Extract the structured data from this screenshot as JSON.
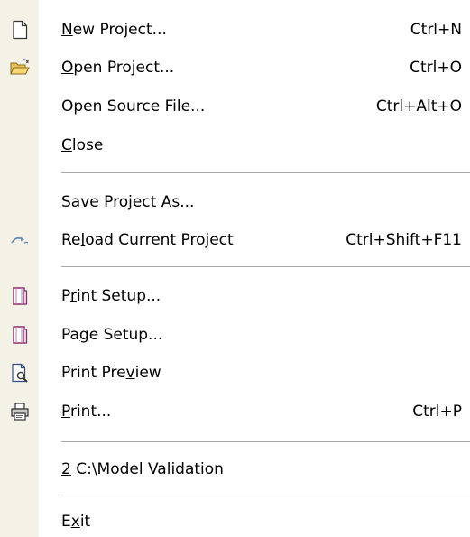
{
  "menu": {
    "colors": {
      "gutter": "#f4f2e7",
      "background": "#ffffff",
      "separator": "#a8a8a8"
    },
    "items": [
      {
        "pre": "",
        "mn": "N",
        "post": "ew Project...",
        "shortcut": "Ctrl+N",
        "icon": "new-project-icon"
      },
      {
        "pre": "",
        "mn": "O",
        "post": "pen Project...",
        "shortcut": "Ctrl+O",
        "icon": "open-folder-icon"
      },
      {
        "pre": "Open Source File...",
        "mn": "",
        "post": "",
        "shortcut": "Ctrl+Alt+O",
        "icon": ""
      },
      {
        "pre": "",
        "mn": "C",
        "post": "lose",
        "shortcut": "",
        "icon": ""
      },
      {
        "pre": "Save Project ",
        "mn": "A",
        "post": "s...",
        "shortcut": "",
        "icon": ""
      },
      {
        "pre": "Re",
        "mn": "l",
        "post": "oad Current Project",
        "shortcut": "Ctrl+Shift+F11",
        "icon": "reload-icon"
      },
      {
        "pre": "P",
        "mn": "r",
        "post": "int Setup...",
        "shortcut": "",
        "icon": "print-setup-icon"
      },
      {
        "pre": "Pa",
        "mn": "g",
        "post": "e Setup...",
        "shortcut": "",
        "icon": "page-setup-icon"
      },
      {
        "pre": "Print Pre",
        "mn": "v",
        "post": "iew",
        "shortcut": "",
        "icon": "print-preview-icon"
      },
      {
        "pre": "",
        "mn": "P",
        "post": "rint...",
        "shortcut": "Ctrl+P",
        "icon": "printer-icon"
      },
      {
        "pre": "",
        "mn": "2",
        "post": " C:\\Model Validation",
        "shortcut": "",
        "icon": ""
      },
      {
        "pre": "E",
        "mn": "x",
        "post": "it",
        "shortcut": "",
        "icon": ""
      }
    ]
  }
}
